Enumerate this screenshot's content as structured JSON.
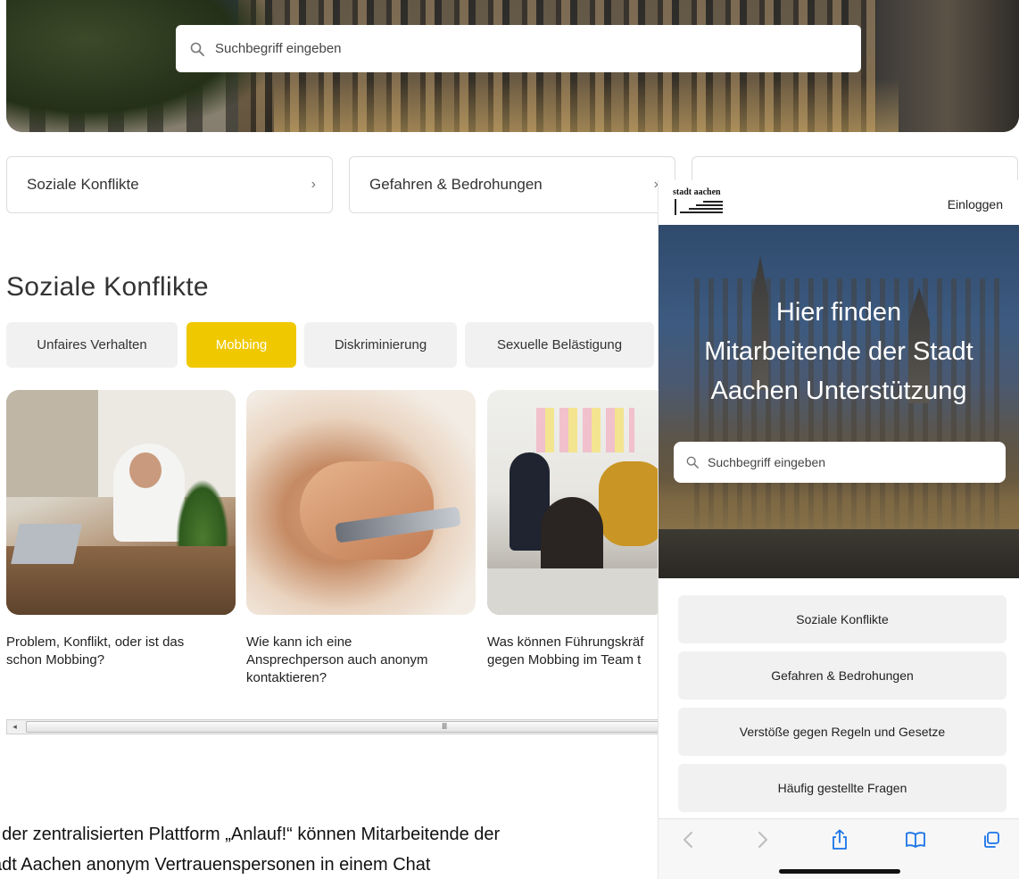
{
  "desktop": {
    "search": {
      "placeholder": "Suchbegriff eingeben"
    },
    "categories": [
      {
        "label": "Soziale Konflikte",
        "chevron": "›"
      },
      {
        "label": "Gefahren & Bedrohungen",
        "chevron": "›"
      },
      {
        "label": "",
        "chevron": ""
      }
    ],
    "section": {
      "title": "Soziale Konflikte",
      "tabs": [
        {
          "label": "Unfaires Verhalten",
          "active": false
        },
        {
          "label": "Mobbing",
          "active": true
        },
        {
          "label": "Diskriminierung",
          "active": false
        },
        {
          "label": "Sexuelle Belästigung",
          "active": false
        }
      ],
      "articles": [
        {
          "title_lines": [
            "Problem, Konflikt, oder ist das",
            "schon Mobbing?"
          ]
        },
        {
          "title_lines": [
            "Wie kann ich eine",
            "Ansprechperson auch anonym",
            "kontaktieren?"
          ]
        },
        {
          "title_lines": [
            "Was können Führungskräf",
            "gegen Mobbing im Team t"
          ]
        }
      ]
    },
    "scrollbar": {
      "left_arrow": "◂",
      "grip": "III"
    },
    "body_text_lines": [
      "f der zentralisierten Plattform „Anlauf!“ können Mitarbeitende der",
      "adt Aachen anonym Vertrauenspersonen in einem Chat"
    ]
  },
  "mobile": {
    "logo_text": "stadt aachen",
    "login_label": "Einloggen",
    "hero_lines": [
      "Hier finden",
      "Mitarbeitende der Stadt",
      "Aachen Unterstützung"
    ],
    "search": {
      "placeholder": "Suchbegriff eingeben"
    },
    "categories": [
      "Soziale Konflikte",
      "Gefahren & Bedrohungen",
      "Verstöße gegen Regeln und Gesetze",
      "Häufig gestellte Fragen"
    ],
    "toolbar_icons": [
      "back-icon",
      "forward-icon",
      "share-icon",
      "bookmarks-icon",
      "tabs-icon"
    ]
  },
  "colors": {
    "accent": "#f0c800",
    "tab_bg": "#f1f1f1",
    "safari_tint": "#1a73e8"
  }
}
